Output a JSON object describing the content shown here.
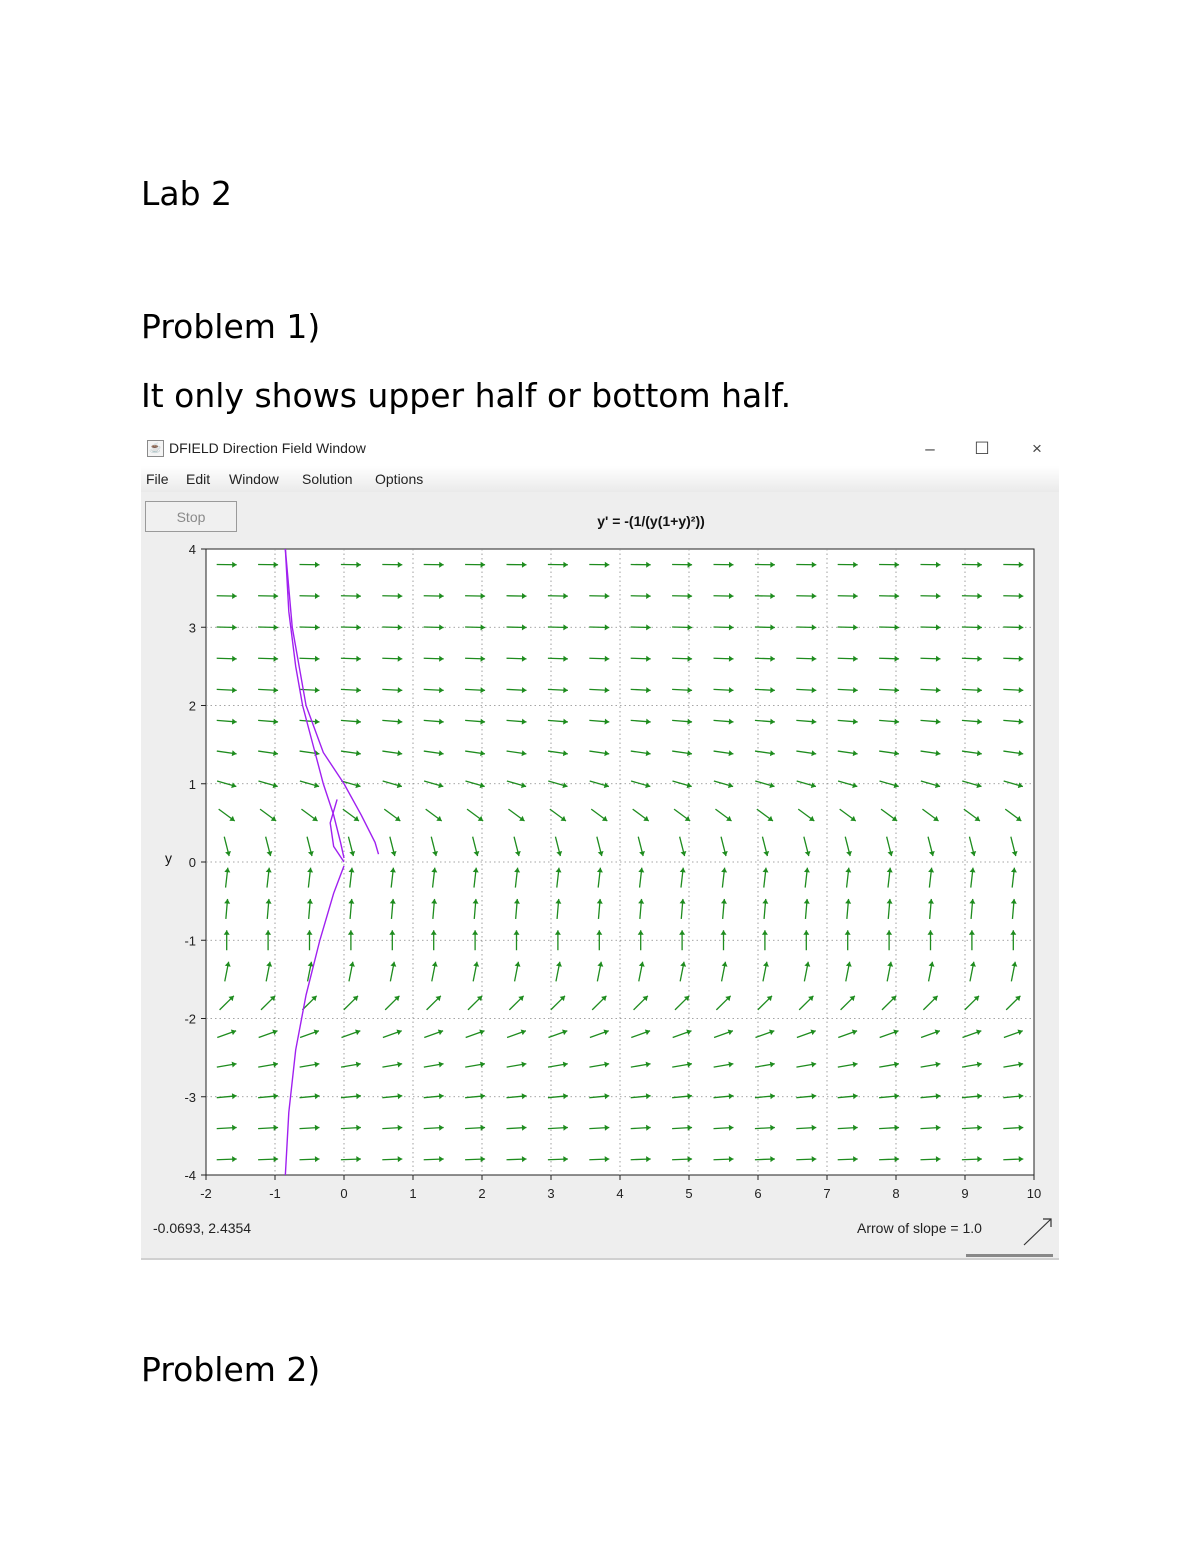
{
  "document": {
    "title": "Lab 2",
    "problem1_heading": "Problem 1)",
    "problem1_text": "It only shows upper half or bottom half.",
    "problem2_heading": "Problem 2)"
  },
  "window": {
    "title": "DFIELD Direction Field Window",
    "controls": {
      "minimize": "–",
      "maximize": "☐",
      "close": "×"
    },
    "menu": [
      "File",
      "Edit",
      "Window",
      "Solution",
      "Options"
    ],
    "stop_label": "Stop",
    "equation": "y' = -(1/(y(1+y)²))",
    "coord_readout": "-0.0693, 2.4354",
    "arrow_slope_label": "Arrow of slope = 1.0"
  },
  "colors": {
    "field": "#1e8c1e",
    "solution": "#a020f0",
    "grid": "#888888"
  },
  "chart_data": {
    "type": "direction field",
    "ylabel": "y",
    "xlim": [
      -2,
      10
    ],
    "ylim": [
      -4,
      4
    ],
    "xticks": [
      -2,
      -1,
      0,
      1,
      2,
      3,
      4,
      5,
      6,
      7,
      8,
      9,
      10
    ],
    "yticks": [
      -4,
      -3,
      -2,
      -1,
      0,
      1,
      2,
      3,
      4
    ],
    "tick_labels_x": [
      "-2",
      "-1",
      "0",
      "1",
      "2",
      "3",
      "4",
      "5",
      "6",
      "7",
      "8",
      "9",
      "10"
    ],
    "tick_labels_y": [
      "-4",
      "-3",
      "-2",
      "-1",
      "0",
      "1",
      "2",
      "3",
      "4"
    ],
    "grid": "dotted",
    "field_equation": "y' = -(1/(y(1+y)²))",
    "solution_curves": [
      {
        "points": [
          [
            -0.85,
            4.0
          ],
          [
            -0.8,
            3.2
          ],
          [
            -0.7,
            2.5
          ],
          [
            -0.6,
            2.0
          ],
          [
            -0.45,
            1.5
          ],
          [
            -0.3,
            1.0
          ],
          [
            -0.15,
            0.6
          ],
          [
            -0.05,
            0.25
          ],
          [
            0.0,
            0.05
          ]
        ]
      },
      {
        "points": [
          [
            -0.85,
            4.0
          ],
          [
            -0.75,
            3.0
          ],
          [
            -0.55,
            2.0
          ],
          [
            -0.3,
            1.4
          ],
          [
            0.0,
            1.0
          ],
          [
            0.25,
            0.6
          ],
          [
            0.45,
            0.25
          ],
          [
            0.5,
            0.1
          ]
        ]
      },
      {
        "points": [
          [
            -0.1,
            0.8
          ],
          [
            -0.2,
            0.5
          ],
          [
            -0.15,
            0.2
          ],
          [
            0.0,
            0.0
          ]
        ]
      },
      {
        "points": [
          [
            0.0,
            -0.05
          ],
          [
            -0.15,
            -0.4
          ],
          [
            -0.35,
            -1.0
          ],
          [
            -0.55,
            -1.7
          ],
          [
            -0.7,
            -2.4
          ],
          [
            -0.8,
            -3.2
          ],
          [
            -0.85,
            -4.0
          ]
        ]
      }
    ]
  }
}
